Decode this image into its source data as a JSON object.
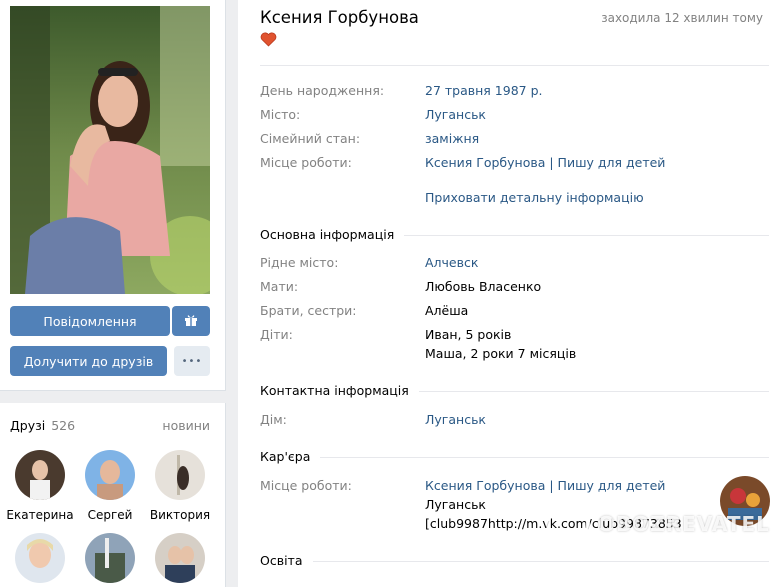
{
  "profile": {
    "name": "Ксения Горбунова",
    "last_seen": "заходила 12 хвилин тому",
    "message_button": "Повідомлення",
    "add_friend_button": "Долучити до друзів",
    "more_button": "•••"
  },
  "friends": {
    "title": "Друзі",
    "count": "526",
    "new_link": "новини",
    "items": [
      {
        "name": "Екатерина"
      },
      {
        "name": "Сергей"
      },
      {
        "name": "Виктория"
      }
    ]
  },
  "info": {
    "rows": [
      {
        "label": "День народження:",
        "value": "27 травня 1987 р."
      },
      {
        "label": "Місто:",
        "value": "Луганськ"
      },
      {
        "label": "Сімейний стан:",
        "value": "заміжня"
      },
      {
        "label": "Місце роботи:",
        "value": "Ксения Горбунова | Пишу для детей"
      }
    ],
    "hide_link": "Приховати детальну інформацію"
  },
  "basic": {
    "title": "Основна інформація",
    "rows": [
      {
        "label": "Рідне місто:",
        "value": "Алчевск"
      },
      {
        "label": "Мати:",
        "value": "Любовь Власенко"
      },
      {
        "label": "Брати, сестри:",
        "value": "Алёша"
      },
      {
        "label": "Діти:",
        "value": "Иван, 5 років",
        "value2": "Маша, 2 роки 7 місяців"
      }
    ]
  },
  "contact": {
    "title": "Контактна інформація",
    "rows": [
      {
        "label": "Дім:",
        "value": "Луганськ"
      }
    ]
  },
  "career": {
    "title": "Кар'єра",
    "label": "Місце роботи:",
    "line1": "Ксения Горбунова | Пишу для детей",
    "line2": "Луганськ",
    "line3": "[club9987http://m.vk.com/club99873853"
  },
  "education": {
    "title": "Освіта"
  },
  "watermark": "OBOZREVATEL",
  "colors": {
    "primary_button": "#5181b8",
    "link": "#2a5885",
    "label_gray": "#828282",
    "page_bg": "#edeef0"
  }
}
